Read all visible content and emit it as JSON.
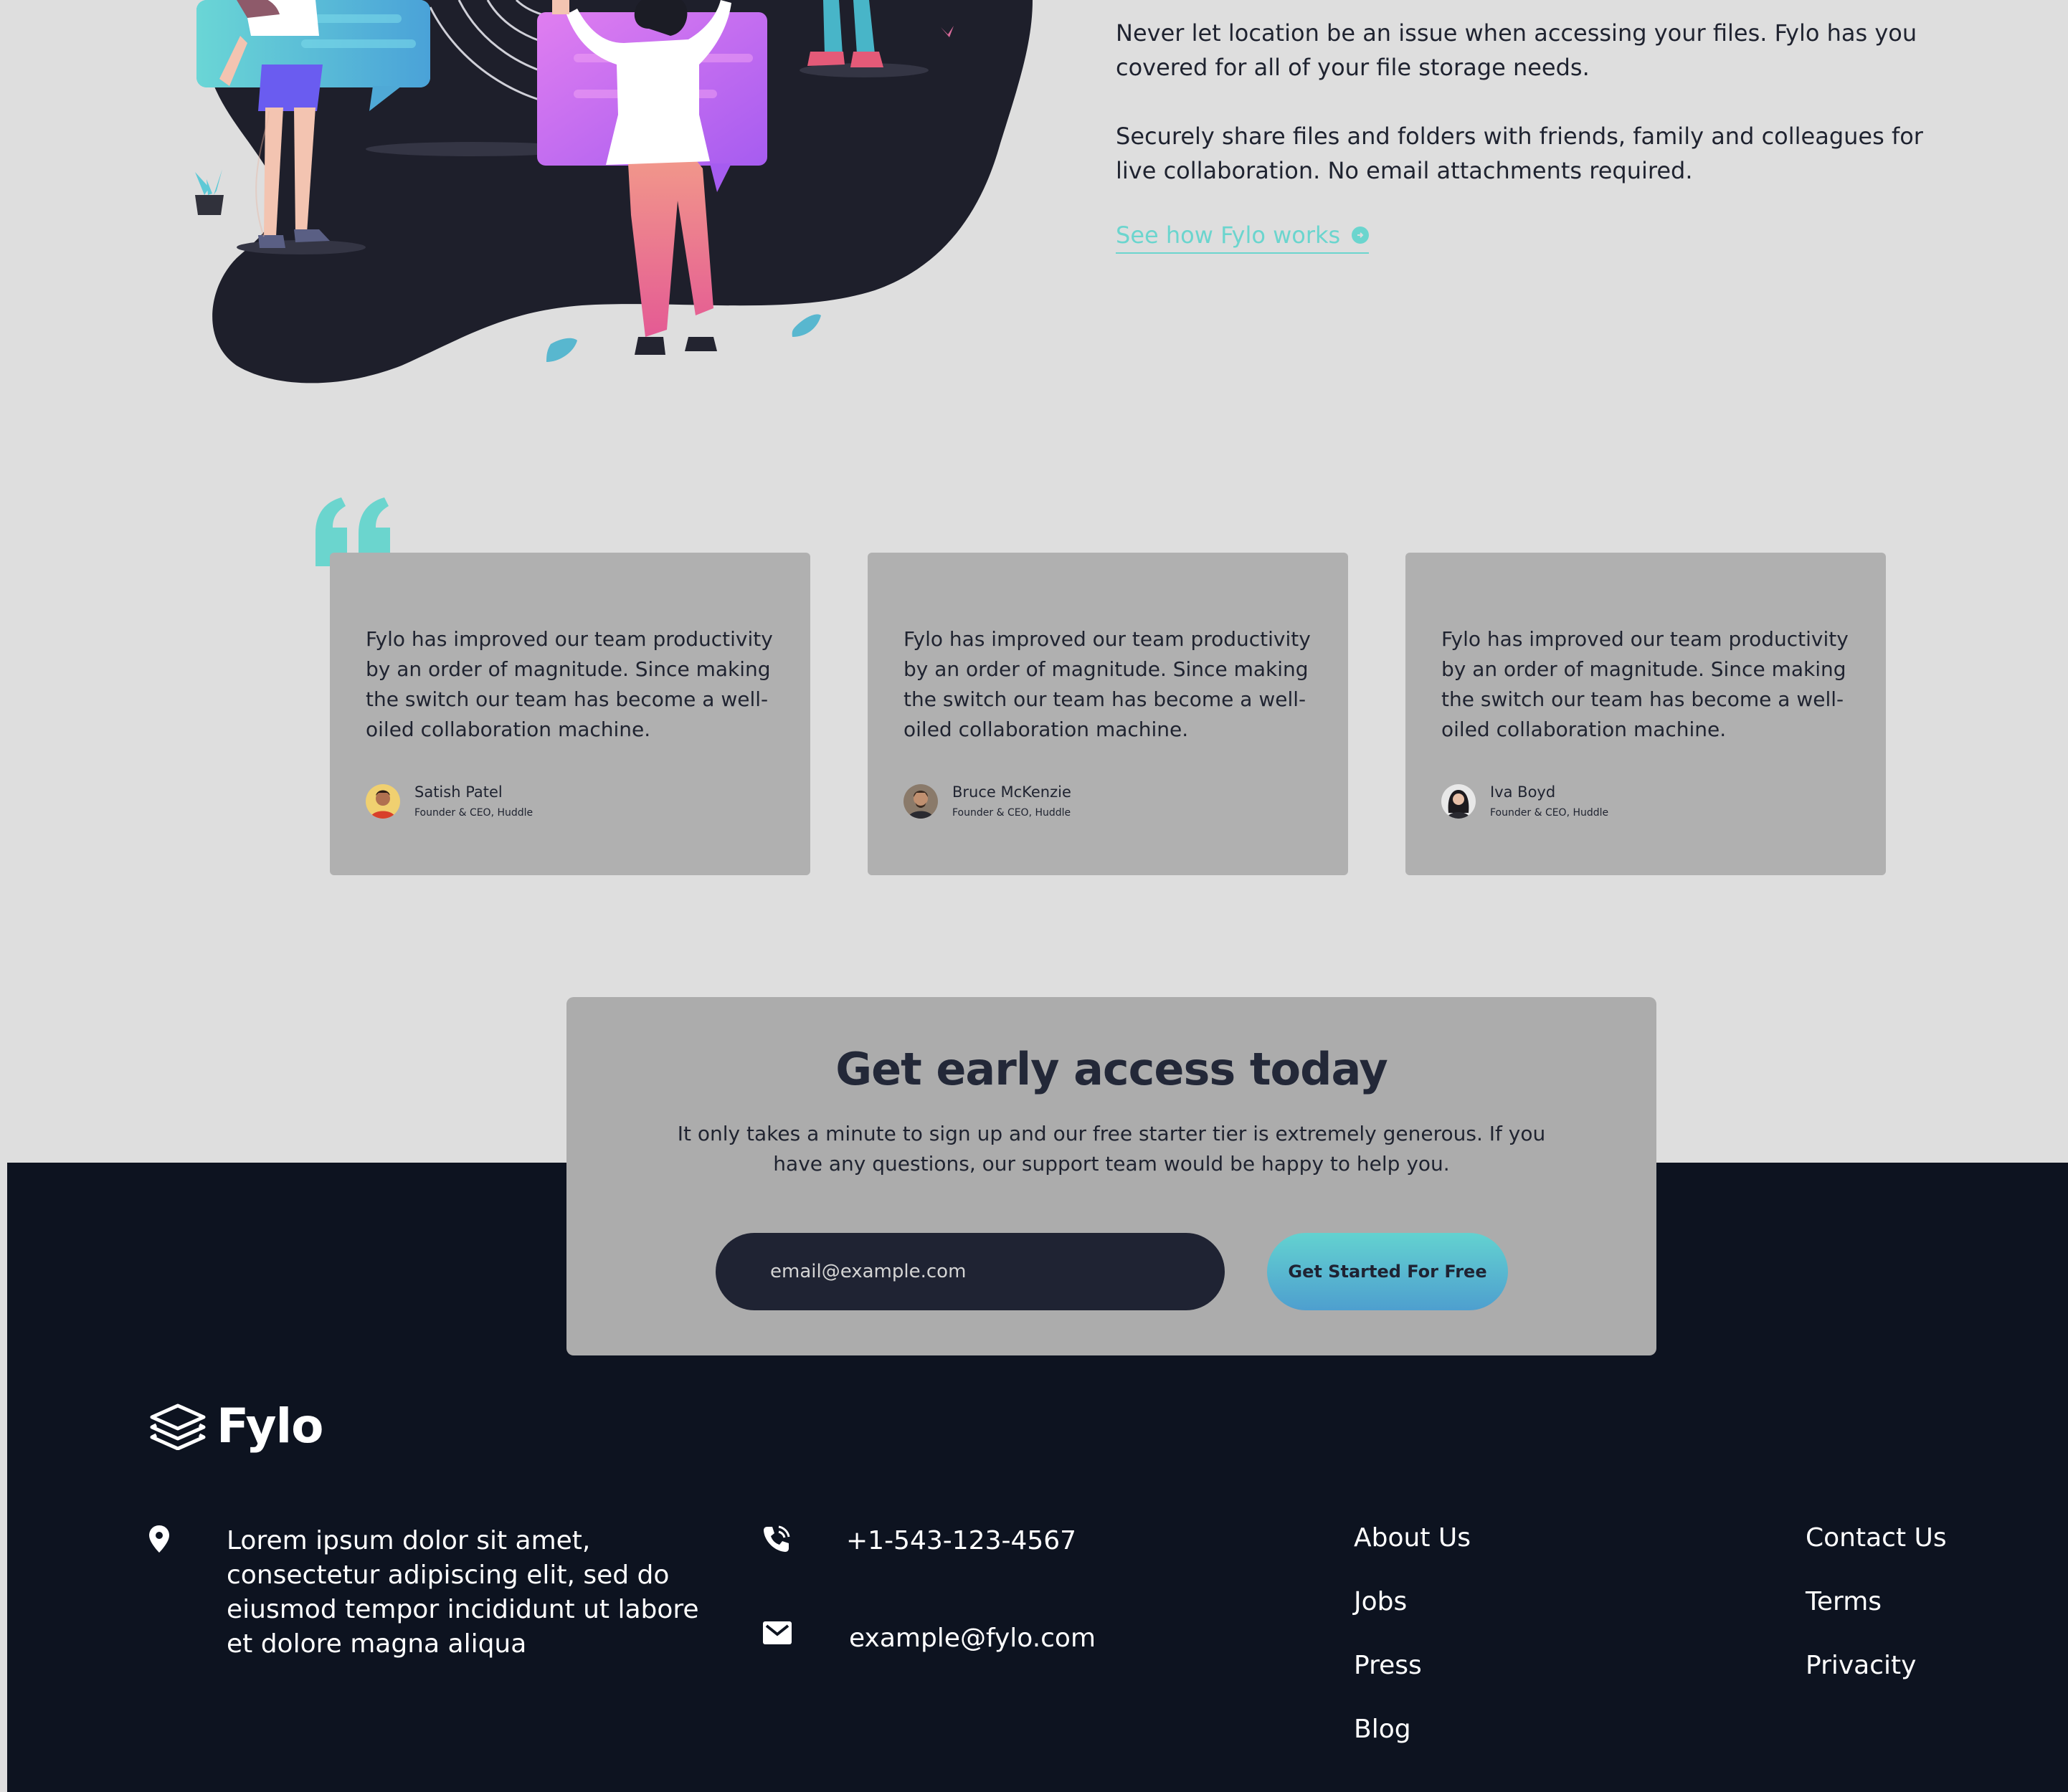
{
  "hero": {
    "paragraph_1": "Never let location be an issue when accessing your files. Fylo has you covered for all of your file storage needs.",
    "paragraph_2": "Securely share files and folders with friends, family and colleagues for live collaboration. No email attachments required.",
    "link_label": "See how Fylo works"
  },
  "testimonials": [
    {
      "quote": "Fylo has improved our team productivity by an order of magnitude. Since making the switch our team has become a well-oiled collaboration machine.",
      "name": "Satish Patel",
      "title": "Founder & CEO, Huddle"
    },
    {
      "quote": "Fylo has improved our team productivity by an order of magnitude. Since making the switch our team has become a well-oiled collaboration machine.",
      "name": "Bruce McKenzie",
      "title": "Founder & CEO, Huddle"
    },
    {
      "quote": "Fylo has improved our team productivity by an order of magnitude. Since making the switch our team has become a well-oiled collaboration machine.",
      "name": "Iva Boyd",
      "title": "Founder & CEO, Huddle"
    }
  ],
  "early_access": {
    "title": "Get early access today",
    "text": "It only takes a minute to sign up and our free starter tier is extremely generous. If you have any questions, our support team would be happy to help you.",
    "email_placeholder": "email@example.com",
    "button_label": "Get Started For Free"
  },
  "footer": {
    "logo_text": "Fylo",
    "address": "Lorem ipsum dolor sit amet, consectetur adipiscing elit, sed do eiusmod tempor incididunt ut labore et dolore magna aliqua",
    "phone": "+1-543-123-4567",
    "email": "example@fylo.com",
    "links_col_1": [
      "About Us",
      "Jobs",
      "Press",
      "Blog"
    ],
    "links_col_2": [
      "Contact Us",
      "Terms",
      "Privacity"
    ]
  },
  "colors": {
    "accent": "#6bd5ce",
    "footer_bg": "#0d1320",
    "card_bg": "#b0b0b0",
    "page_bg": "#dedede"
  },
  "icons": [
    "arrow-right-circle-icon",
    "quote-icon",
    "location-pin-icon",
    "phone-icon",
    "mail-icon",
    "stacked-layers-logo-icon"
  ]
}
